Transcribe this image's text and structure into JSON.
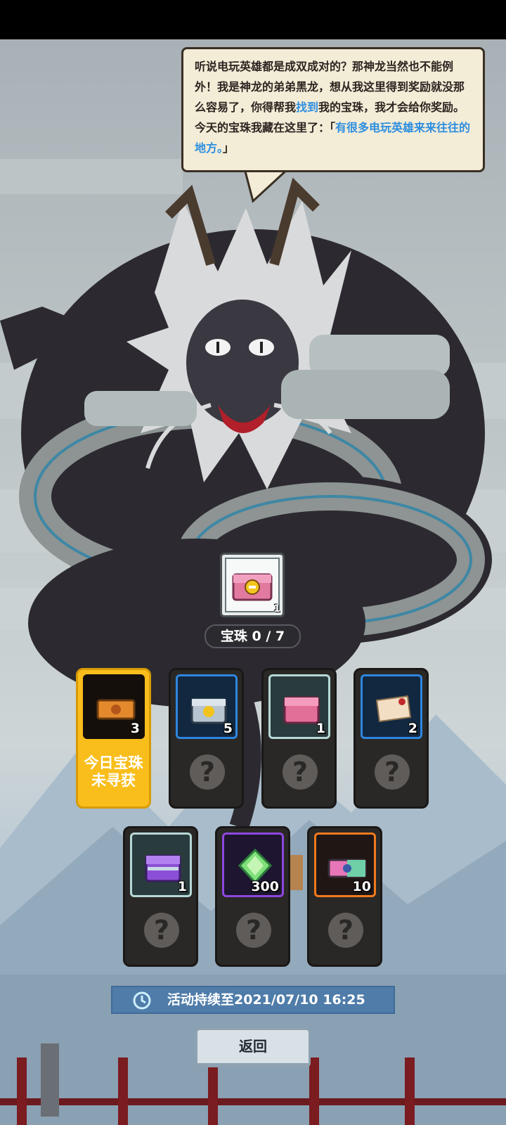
{
  "dialogue": {
    "part1": "听说电玩英雄都是成双成对的？那神龙当然也不能例外！我是神龙的弟弟黑龙，想从我这里得到奖励就没那么容易了，你得帮我",
    "highlight1": "找到",
    "part2": "我的宝珠，我才会给你奖励。今天的宝珠我藏在这里了：「",
    "highlight2": "有很多电玩英雄来来往往的地方。",
    "part3": "」"
  },
  "main_prize": {
    "icon": "pink-gold-chest-icon",
    "count": "1"
  },
  "pearl_progress": "宝珠 0 / 7",
  "cards_row1": [
    {
      "icon": "bronze-ticket-icon",
      "count": "3",
      "status": "今日宝珠未寻获",
      "active": true,
      "frame": "black"
    },
    {
      "icon": "blue-chest-icon",
      "count": "5",
      "question": "?",
      "frame": "blue"
    },
    {
      "icon": "pink-chest-icon",
      "count": "1",
      "question": "?",
      "frame": "teal"
    },
    {
      "icon": "scroll-icon",
      "count": "2",
      "question": "?",
      "frame": "blue"
    }
  ],
  "cards_row2": [
    {
      "icon": "purple-chest-icon",
      "count": "1",
      "question": "?",
      "frame": "teal"
    },
    {
      "icon": "green-gem-icon",
      "count": "300",
      "question": "?",
      "frame": "purple"
    },
    {
      "icon": "rainbow-ticket-icon",
      "count": "10",
      "question": "?",
      "frame": "orange"
    }
  ],
  "timer": {
    "icon": "clock-icon",
    "text": "活动持续至2021/07/10 16:25"
  },
  "back_button": "返回",
  "colors": {
    "active_card": "#f9be1c",
    "highlight_text": "#2d8ee0",
    "timer_bg": "#4f7ca9"
  }
}
